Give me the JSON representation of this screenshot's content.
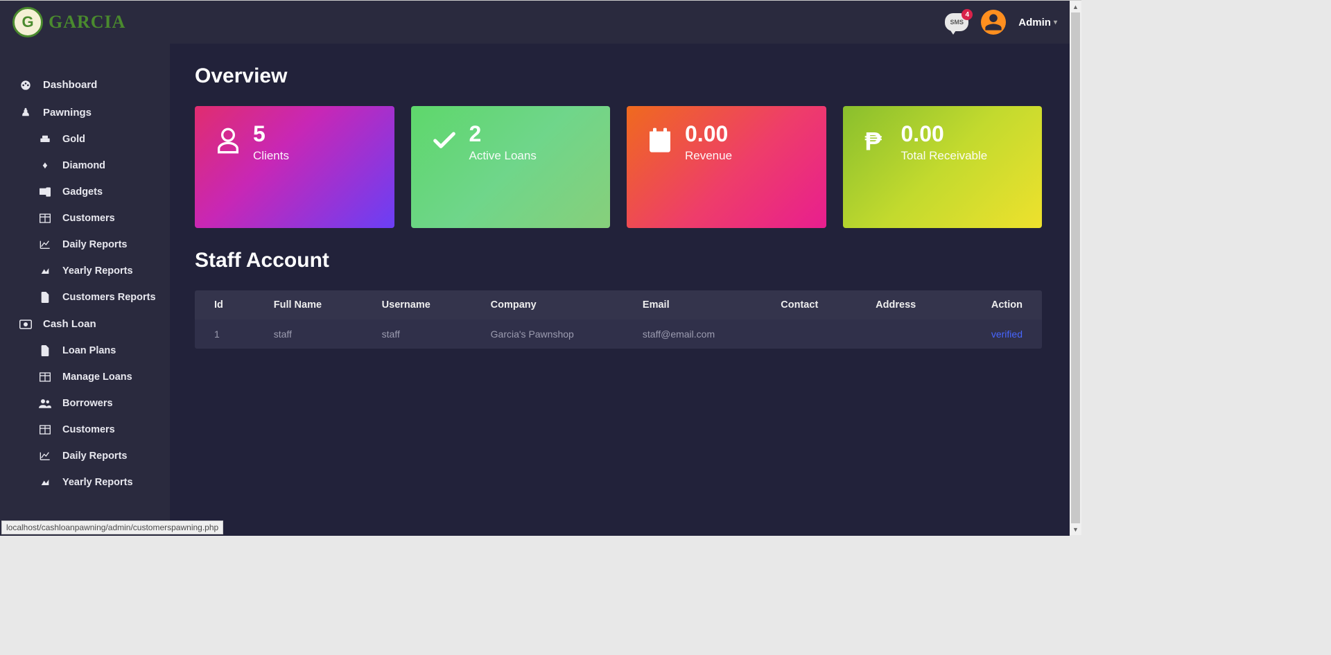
{
  "brand": "GARCIA",
  "sms_badge": "4",
  "sms_label": "SMS",
  "user_name": "Admin",
  "sidebar": {
    "dashboard": "Dashboard",
    "pawnings": "Pawnings",
    "gold": "Gold",
    "diamond": "Diamond",
    "gadgets": "Gadgets",
    "customers1": "Customers",
    "daily1": "Daily Reports",
    "yearly1": "Yearly Reports",
    "custreports": "Customers Reports",
    "cashloan": "Cash Loan",
    "loanplans": "Loan Plans",
    "manageloans": "Manage Loans",
    "borrowers": "Borrowers",
    "customers2": "Customers",
    "daily2": "Daily Reports",
    "yearly2": "Yearly Reports"
  },
  "overview_title": "Overview",
  "cards": {
    "clients_value": "5",
    "clients_label": "Clients",
    "loans_value": "2",
    "loans_label": "Active Loans",
    "revenue_value": "0.00",
    "revenue_label": "Revenue",
    "receivable_value": "0.00",
    "receivable_label": "Total Receivable"
  },
  "staff_title": "Staff Account",
  "table": {
    "headers": {
      "id": "Id",
      "fullname": "Full Name",
      "username": "Username",
      "company": "Company",
      "email": "Email",
      "contact": "Contact",
      "address": "Address",
      "action": "Action"
    },
    "row": {
      "id": "1",
      "fullname": "staff",
      "username": "staff",
      "company": "Garcia's Pawnshop",
      "email": "staff@email.com",
      "contact": "",
      "address": "",
      "action": "verified"
    }
  },
  "status_url": "localhost/cashloanpawning/admin/customerspawning.php"
}
